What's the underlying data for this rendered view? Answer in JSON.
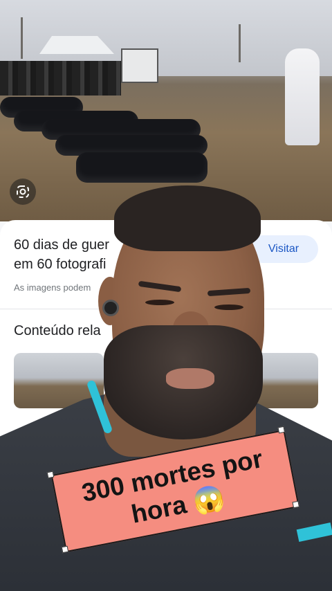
{
  "image_card": {
    "title_line1": "60 dias de guer",
    "title_line2": "em 60 fotografi",
    "notice": "As imagens podem",
    "visit_label": "Visitar"
  },
  "related": {
    "heading": "Conteúdo rela"
  },
  "lens": {
    "icon": "google-lens-icon"
  },
  "caption": {
    "text_line1": "300 mortes por",
    "text_line2": "hora",
    "emoji": "😱"
  },
  "colors": {
    "caption_bg": "#f58d80",
    "visit_text": "#1a56c4",
    "visit_bg": "#e8f0fe",
    "accent_teal": "#2fc2d8"
  }
}
